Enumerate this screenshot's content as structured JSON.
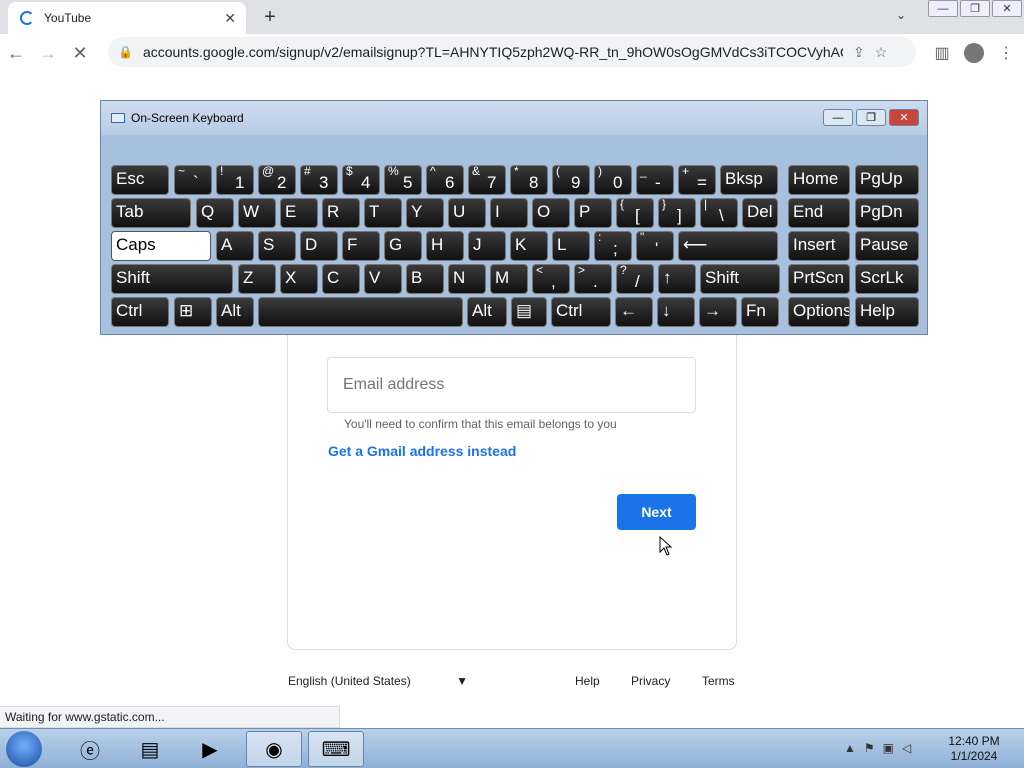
{
  "browser": {
    "tab_title": "YouTube",
    "tab_close": "✕",
    "new_tab": "+",
    "url": "accounts.google.com/signup/v2/emailsignup?TL=AHNYTIQ5zph2WQ-RR_tn_9hOW0sOgGMVdCs3iTCOCVyhAQ...",
    "back": "←",
    "forward": "→",
    "stop": "✕",
    "tab_menu": "⌄"
  },
  "window_buttons": {
    "minimize": "—",
    "restore": "❐",
    "close": "✕"
  },
  "form": {
    "email_placeholder": "Email address",
    "hint": "You'll need to confirm that this email belongs to you",
    "gmail_link": "Get a Gmail address instead",
    "next_button": "Next"
  },
  "footer": {
    "language": "English (United States)",
    "help": "Help",
    "privacy": "Privacy",
    "terms": "Terms"
  },
  "status_bar": "Waiting for www.gstatic.com...",
  "osk": {
    "title": "On-Screen Keyboard",
    "rows": [
      [
        {
          "u": "",
          "l": "Esc"
        },
        {
          "u": "~",
          "l": "`"
        },
        {
          "u": "!",
          "l": "1"
        },
        {
          "u": "@",
          "l": "2"
        },
        {
          "u": "#",
          "l": "3"
        },
        {
          "u": "$",
          "l": "4"
        },
        {
          "u": "%",
          "l": "5"
        },
        {
          "u": "^",
          "l": "6"
        },
        {
          "u": "&",
          "l": "7"
        },
        {
          "u": "*",
          "l": "8"
        },
        {
          "u": "(",
          "l": "9"
        },
        {
          "u": ")",
          "l": "0"
        },
        {
          "u": "_",
          "l": "-"
        },
        {
          "u": "+",
          "l": "="
        },
        {
          "u": "",
          "l": "Bksp"
        },
        {
          "u": "",
          "l": "Home"
        },
        {
          "u": "",
          "l": "PgUp"
        }
      ],
      [
        {
          "u": "",
          "l": "Tab"
        },
        {
          "u": "",
          "l": "Q"
        },
        {
          "u": "",
          "l": "W"
        },
        {
          "u": "",
          "l": "E"
        },
        {
          "u": "",
          "l": "R"
        },
        {
          "u": "",
          "l": "T"
        },
        {
          "u": "",
          "l": "Y"
        },
        {
          "u": "",
          "l": "U"
        },
        {
          "u": "",
          "l": "I"
        },
        {
          "u": "",
          "l": "O"
        },
        {
          "u": "",
          "l": "P"
        },
        {
          "u": "{",
          "l": "["
        },
        {
          "u": "}",
          "l": "]"
        },
        {
          "u": "|",
          "l": "\\"
        },
        {
          "u": "",
          "l": "Del"
        },
        {
          "u": "",
          "l": "End"
        },
        {
          "u": "",
          "l": "PgDn"
        }
      ],
      [
        {
          "u": "",
          "l": "Caps"
        },
        {
          "u": "",
          "l": "A"
        },
        {
          "u": "",
          "l": "S"
        },
        {
          "u": "",
          "l": "D"
        },
        {
          "u": "",
          "l": "F"
        },
        {
          "u": "",
          "l": "G"
        },
        {
          "u": "",
          "l": "H"
        },
        {
          "u": "",
          "l": "J"
        },
        {
          "u": "",
          "l": "K"
        },
        {
          "u": "",
          "l": "L"
        },
        {
          "u": ":",
          "l": ";"
        },
        {
          "u": "\"",
          "l": "'"
        },
        {
          "u": "",
          "l": "⟵"
        },
        {
          "u": "",
          "l": "Insert"
        },
        {
          "u": "",
          "l": "Pause"
        }
      ],
      [
        {
          "u": "",
          "l": "Shift"
        },
        {
          "u": "",
          "l": "Z"
        },
        {
          "u": "",
          "l": "X"
        },
        {
          "u": "",
          "l": "C"
        },
        {
          "u": "",
          "l": "V"
        },
        {
          "u": "",
          "l": "B"
        },
        {
          "u": "",
          "l": "N"
        },
        {
          "u": "",
          "l": "M"
        },
        {
          "u": "<",
          "l": ","
        },
        {
          "u": ">",
          "l": "."
        },
        {
          "u": "?",
          "l": "/"
        },
        {
          "u": "",
          "l": "↑"
        },
        {
          "u": "",
          "l": "Shift"
        },
        {
          "u": "",
          "l": "PrtScn"
        },
        {
          "u": "",
          "l": "ScrLk"
        }
      ],
      [
        {
          "u": "",
          "l": "Ctrl"
        },
        {
          "u": "",
          "l": "⊞"
        },
        {
          "u": "",
          "l": "Alt"
        },
        {
          "u": "",
          "l": ""
        },
        {
          "u": "",
          "l": "Alt"
        },
        {
          "u": "",
          "l": "▤"
        },
        {
          "u": "",
          "l": "Ctrl"
        },
        {
          "u": "",
          "l": "←"
        },
        {
          "u": "",
          "l": "↓"
        },
        {
          "u": "",
          "l": "→"
        },
        {
          "u": "",
          "l": "Fn"
        },
        {
          "u": "",
          "l": "Options"
        },
        {
          "u": "",
          "l": "Help"
        }
      ]
    ]
  },
  "taskbar": {
    "time": "12:40 PM",
    "date": "1/1/2024"
  }
}
